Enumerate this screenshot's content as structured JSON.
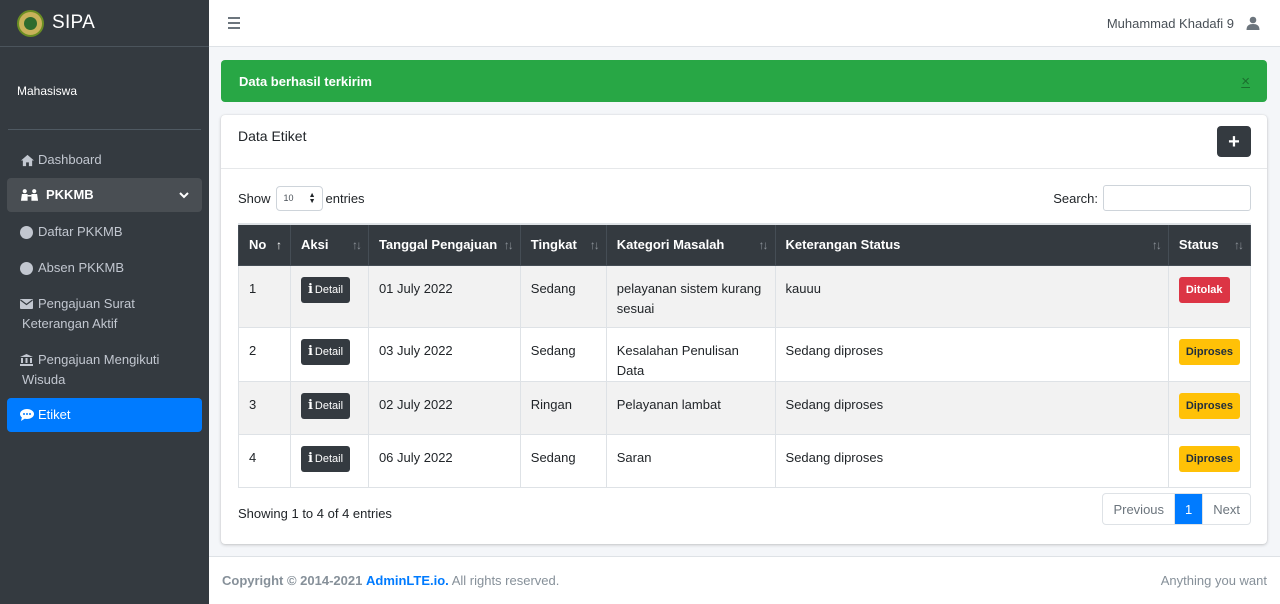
{
  "brand": {
    "name": "SIPA"
  },
  "user_panel": {
    "role": "Mahasiswa"
  },
  "sidebar": {
    "items": [
      {
        "label": "Dashboard",
        "icon": "home-icon"
      },
      {
        "label": "PKKMB",
        "icon": "users-icon"
      },
      {
        "label": "Daftar PKKMB",
        "icon": "circle-icon"
      },
      {
        "label": "Absen PKKMB",
        "icon": "circle-icon"
      },
      {
        "label": "Pengajuan Surat",
        "label2": "Keterangan Aktif",
        "icon": "envelope-icon"
      },
      {
        "label": "Pengajuan Mengikuti",
        "label2": "Wisuda",
        "icon": "university-icon"
      },
      {
        "label": "Etiket",
        "icon": "comment-icon"
      }
    ]
  },
  "topbar": {
    "user_name": "Muhammad Khadafi 9"
  },
  "alert": {
    "message": "Data berhasil terkirim",
    "close": "×"
  },
  "card": {
    "title": "Data Etiket",
    "add_label": "+",
    "show_label": "Show",
    "entries_value": "10",
    "entries_label": "entries",
    "search_label": "Search:",
    "search_value": ""
  },
  "table": {
    "headers": [
      "No",
      "Aksi",
      "Tanggal Pengajuan",
      "Tingkat",
      "Kategori Masalah",
      "Keterangan Status",
      "Status"
    ],
    "detail_label": "Detail",
    "rows": [
      {
        "no": "1",
        "tanggal": "01 July 2022",
        "tingkat": "Sedang",
        "kategori": "pelayanan sistem kurang sesuai",
        "keterangan": "kauuu",
        "status": "Ditolak"
      },
      {
        "no": "2",
        "tanggal": "03 July 2022",
        "tingkat": "Sedang",
        "kategori": "Kesalahan Penulisan Data",
        "keterangan": "Sedang diproses",
        "status": "Diproses"
      },
      {
        "no": "3",
        "tanggal": "02 July 2022",
        "tingkat": "Ringan",
        "kategori": "Pelayanan lambat",
        "keterangan": "Sedang diproses",
        "status": "Diproses"
      },
      {
        "no": "4",
        "tanggal": "06 July 2022",
        "tingkat": "Sedang",
        "kategori": "Saran",
        "keterangan": "Sedang diproses",
        "status": "Diproses"
      }
    ]
  },
  "pagination": {
    "info": "Showing 1 to 4 of 4 entries",
    "previous": "Previous",
    "current": "1",
    "next": "Next"
  },
  "footer": {
    "copyright": "Copyright © 2014-2021",
    "link": "AdminLTE.io.",
    "rights": "All rights reserved.",
    "right_text": "Anything you want"
  },
  "colors": {
    "sidebar": "#343a40",
    "active": "#007bff",
    "success": "#28a745",
    "danger": "#dc3545",
    "warning": "#ffc107"
  }
}
